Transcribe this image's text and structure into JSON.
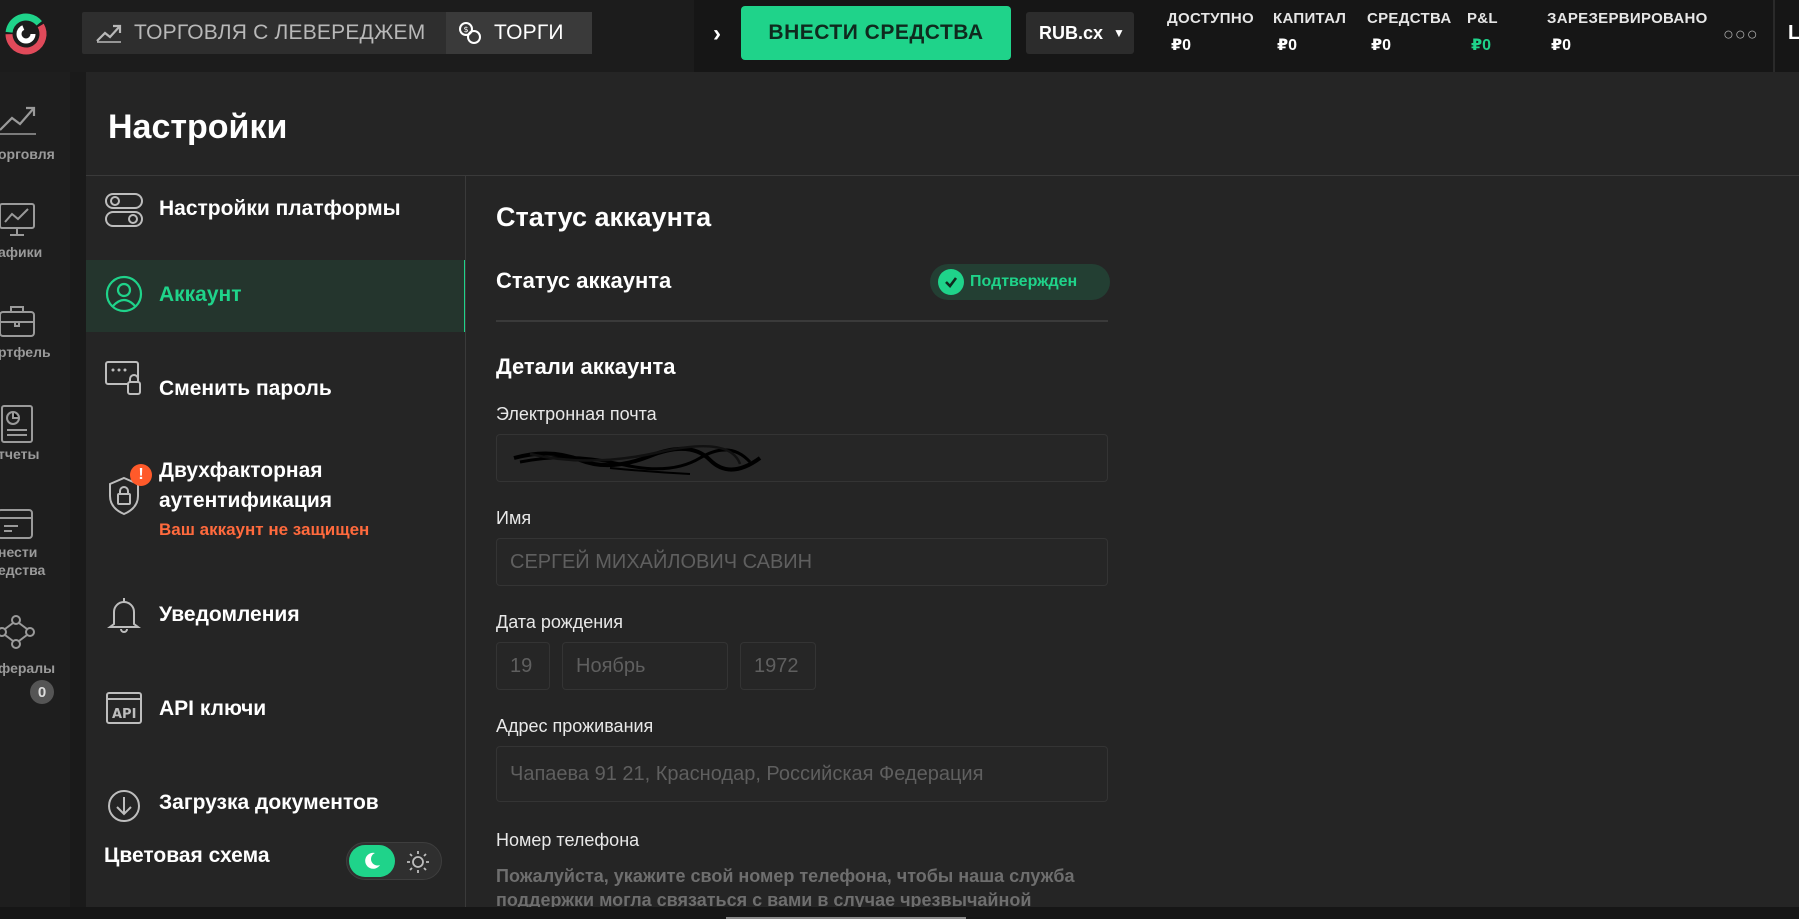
{
  "topbar": {
    "mode_leverage": "ТОРГОВЛЯ С ЛЕВЕРЕДЖЕМ",
    "mode_trade": "ТОРГИ",
    "deposit_label": "ВНЕСТИ СРЕДСТВА",
    "currency": "RUB.cx",
    "stats": [
      {
        "label": "ДОСТУПНО",
        "value": "₽0"
      },
      {
        "label": "КАПИТАЛ",
        "value": "₽0"
      },
      {
        "label": "СРЕДСТВА",
        "value": "₽0"
      },
      {
        "label": "P&L",
        "value": "₽0"
      },
      {
        "label": "ЗАРЕЗЕРВИРОВАНО",
        "value": "₽0"
      }
    ],
    "more": "○○○",
    "edge_letter": "L",
    "accent": "#1fd38a"
  },
  "rail": {
    "items": [
      {
        "label": "орговля",
        "icon": "trend-up-icon"
      },
      {
        "label": "афики",
        "icon": "chart-monitor-icon"
      },
      {
        "label": "ртфель",
        "icon": "briefcase-icon"
      },
      {
        "label": "тчеты",
        "icon": "report-icon"
      },
      {
        "label": "нести",
        "label2": "едства",
        "icon": "wallet-icon"
      },
      {
        "label": "фералы",
        "icon": "referral-network-icon"
      }
    ],
    "referral_count": "0",
    "more": "ooo"
  },
  "page": {
    "title": "Настройки"
  },
  "nav": {
    "items": [
      {
        "label": "Настройки платформы",
        "icon": "toggles-icon"
      },
      {
        "label": "Аккаунт",
        "icon": "user-circle-icon"
      },
      {
        "label": "Сменить пароль",
        "icon": "password-lock-icon"
      },
      {
        "label": "Двухфакторная",
        "label2": "аутентификация",
        "warning": "Ваш аккаунт не защищен",
        "icon": "shield-lock-icon"
      },
      {
        "label": "Уведомления",
        "icon": "bell-icon"
      },
      {
        "label": "API ключи",
        "icon": "api-icon"
      },
      {
        "label": "Загрузка документов",
        "icon": "download-icon"
      }
    ],
    "warning_mark": "!",
    "color_scheme_label": "Цветовая схема"
  },
  "content": {
    "status_heading": "Статус аккаунта",
    "status_row_label": "Статус аккаунта",
    "status_badge": "Подтвержден",
    "details_heading": "Детали аккаунта",
    "email_label": "Электронная почта",
    "name_label": "Имя",
    "name_value": "СЕРГЕЙ МИХАЙЛОВИЧ САВИН",
    "dob_label": "Дата рождения",
    "dob_day": "19",
    "dob_month": "Ноябрь",
    "dob_year": "1972",
    "address_label": "Адрес проживания",
    "address_value": "Чапаева 91 21, Краснодар, Российская Федерация",
    "phone_label": "Номер телефона",
    "phone_hint": "Пожалуйста, укажите свой номер телефона, чтобы наша служба поддержки могла связаться с вами в случае чрезвычайной"
  }
}
